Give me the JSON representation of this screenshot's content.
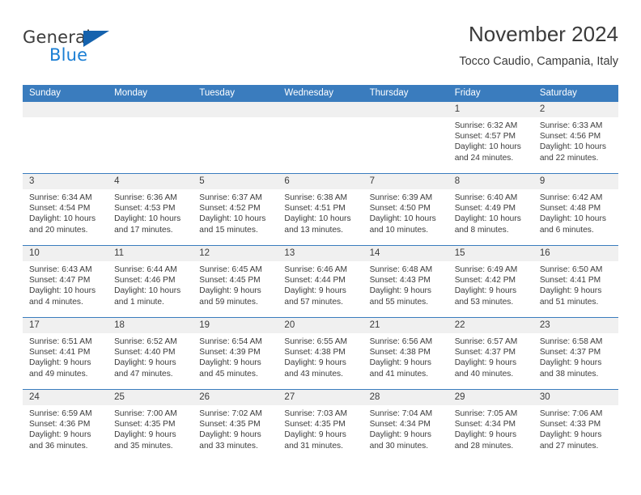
{
  "brand": {
    "name_part1": "General",
    "name_part2": "Blue",
    "logo_icon": "triangle-logo-icon"
  },
  "header": {
    "title": "November 2024",
    "subtitle": "Tocco Caudio, Campania, Italy"
  },
  "colors": {
    "header_blue": "#3a7cbe",
    "brand_blue": "#1b7fd4",
    "logo_blue": "#1562ad",
    "daynum_bg": "#f0f0f0",
    "text": "#3b3b3b"
  },
  "weekdays": [
    "Sunday",
    "Monday",
    "Tuesday",
    "Wednesday",
    "Thursday",
    "Friday",
    "Saturday"
  ],
  "weeks": [
    [
      {
        "day": "",
        "sunrise": "",
        "sunset": "",
        "daylight": "",
        "empty": true
      },
      {
        "day": "",
        "sunrise": "",
        "sunset": "",
        "daylight": "",
        "empty": true
      },
      {
        "day": "",
        "sunrise": "",
        "sunset": "",
        "daylight": "",
        "empty": true
      },
      {
        "day": "",
        "sunrise": "",
        "sunset": "",
        "daylight": "",
        "empty": true
      },
      {
        "day": "",
        "sunrise": "",
        "sunset": "",
        "daylight": "",
        "empty": true
      },
      {
        "day": "1",
        "sunrise": "Sunrise: 6:32 AM",
        "sunset": "Sunset: 4:57 PM",
        "daylight": "Daylight: 10 hours and 24 minutes."
      },
      {
        "day": "2",
        "sunrise": "Sunrise: 6:33 AM",
        "sunset": "Sunset: 4:56 PM",
        "daylight": "Daylight: 10 hours and 22 minutes."
      }
    ],
    [
      {
        "day": "3",
        "sunrise": "Sunrise: 6:34 AM",
        "sunset": "Sunset: 4:54 PM",
        "daylight": "Daylight: 10 hours and 20 minutes."
      },
      {
        "day": "4",
        "sunrise": "Sunrise: 6:36 AM",
        "sunset": "Sunset: 4:53 PM",
        "daylight": "Daylight: 10 hours and 17 minutes."
      },
      {
        "day": "5",
        "sunrise": "Sunrise: 6:37 AM",
        "sunset": "Sunset: 4:52 PM",
        "daylight": "Daylight: 10 hours and 15 minutes."
      },
      {
        "day": "6",
        "sunrise": "Sunrise: 6:38 AM",
        "sunset": "Sunset: 4:51 PM",
        "daylight": "Daylight: 10 hours and 13 minutes."
      },
      {
        "day": "7",
        "sunrise": "Sunrise: 6:39 AM",
        "sunset": "Sunset: 4:50 PM",
        "daylight": "Daylight: 10 hours and 10 minutes."
      },
      {
        "day": "8",
        "sunrise": "Sunrise: 6:40 AM",
        "sunset": "Sunset: 4:49 PM",
        "daylight": "Daylight: 10 hours and 8 minutes."
      },
      {
        "day": "9",
        "sunrise": "Sunrise: 6:42 AM",
        "sunset": "Sunset: 4:48 PM",
        "daylight": "Daylight: 10 hours and 6 minutes."
      }
    ],
    [
      {
        "day": "10",
        "sunrise": "Sunrise: 6:43 AM",
        "sunset": "Sunset: 4:47 PM",
        "daylight": "Daylight: 10 hours and 4 minutes."
      },
      {
        "day": "11",
        "sunrise": "Sunrise: 6:44 AM",
        "sunset": "Sunset: 4:46 PM",
        "daylight": "Daylight: 10 hours and 1 minute."
      },
      {
        "day": "12",
        "sunrise": "Sunrise: 6:45 AM",
        "sunset": "Sunset: 4:45 PM",
        "daylight": "Daylight: 9 hours and 59 minutes."
      },
      {
        "day": "13",
        "sunrise": "Sunrise: 6:46 AM",
        "sunset": "Sunset: 4:44 PM",
        "daylight": "Daylight: 9 hours and 57 minutes."
      },
      {
        "day": "14",
        "sunrise": "Sunrise: 6:48 AM",
        "sunset": "Sunset: 4:43 PM",
        "daylight": "Daylight: 9 hours and 55 minutes."
      },
      {
        "day": "15",
        "sunrise": "Sunrise: 6:49 AM",
        "sunset": "Sunset: 4:42 PM",
        "daylight": "Daylight: 9 hours and 53 minutes."
      },
      {
        "day": "16",
        "sunrise": "Sunrise: 6:50 AM",
        "sunset": "Sunset: 4:41 PM",
        "daylight": "Daylight: 9 hours and 51 minutes."
      }
    ],
    [
      {
        "day": "17",
        "sunrise": "Sunrise: 6:51 AM",
        "sunset": "Sunset: 4:41 PM",
        "daylight": "Daylight: 9 hours and 49 minutes."
      },
      {
        "day": "18",
        "sunrise": "Sunrise: 6:52 AM",
        "sunset": "Sunset: 4:40 PM",
        "daylight": "Daylight: 9 hours and 47 minutes."
      },
      {
        "day": "19",
        "sunrise": "Sunrise: 6:54 AM",
        "sunset": "Sunset: 4:39 PM",
        "daylight": "Daylight: 9 hours and 45 minutes."
      },
      {
        "day": "20",
        "sunrise": "Sunrise: 6:55 AM",
        "sunset": "Sunset: 4:38 PM",
        "daylight": "Daylight: 9 hours and 43 minutes."
      },
      {
        "day": "21",
        "sunrise": "Sunrise: 6:56 AM",
        "sunset": "Sunset: 4:38 PM",
        "daylight": "Daylight: 9 hours and 41 minutes."
      },
      {
        "day": "22",
        "sunrise": "Sunrise: 6:57 AM",
        "sunset": "Sunset: 4:37 PM",
        "daylight": "Daylight: 9 hours and 40 minutes."
      },
      {
        "day": "23",
        "sunrise": "Sunrise: 6:58 AM",
        "sunset": "Sunset: 4:37 PM",
        "daylight": "Daylight: 9 hours and 38 minutes."
      }
    ],
    [
      {
        "day": "24",
        "sunrise": "Sunrise: 6:59 AM",
        "sunset": "Sunset: 4:36 PM",
        "daylight": "Daylight: 9 hours and 36 minutes."
      },
      {
        "day": "25",
        "sunrise": "Sunrise: 7:00 AM",
        "sunset": "Sunset: 4:35 PM",
        "daylight": "Daylight: 9 hours and 35 minutes."
      },
      {
        "day": "26",
        "sunrise": "Sunrise: 7:02 AM",
        "sunset": "Sunset: 4:35 PM",
        "daylight": "Daylight: 9 hours and 33 minutes."
      },
      {
        "day": "27",
        "sunrise": "Sunrise: 7:03 AM",
        "sunset": "Sunset: 4:35 PM",
        "daylight": "Daylight: 9 hours and 31 minutes."
      },
      {
        "day": "28",
        "sunrise": "Sunrise: 7:04 AM",
        "sunset": "Sunset: 4:34 PM",
        "daylight": "Daylight: 9 hours and 30 minutes."
      },
      {
        "day": "29",
        "sunrise": "Sunrise: 7:05 AM",
        "sunset": "Sunset: 4:34 PM",
        "daylight": "Daylight: 9 hours and 28 minutes."
      },
      {
        "day": "30",
        "sunrise": "Sunrise: 7:06 AM",
        "sunset": "Sunset: 4:33 PM",
        "daylight": "Daylight: 9 hours and 27 minutes."
      }
    ]
  ]
}
